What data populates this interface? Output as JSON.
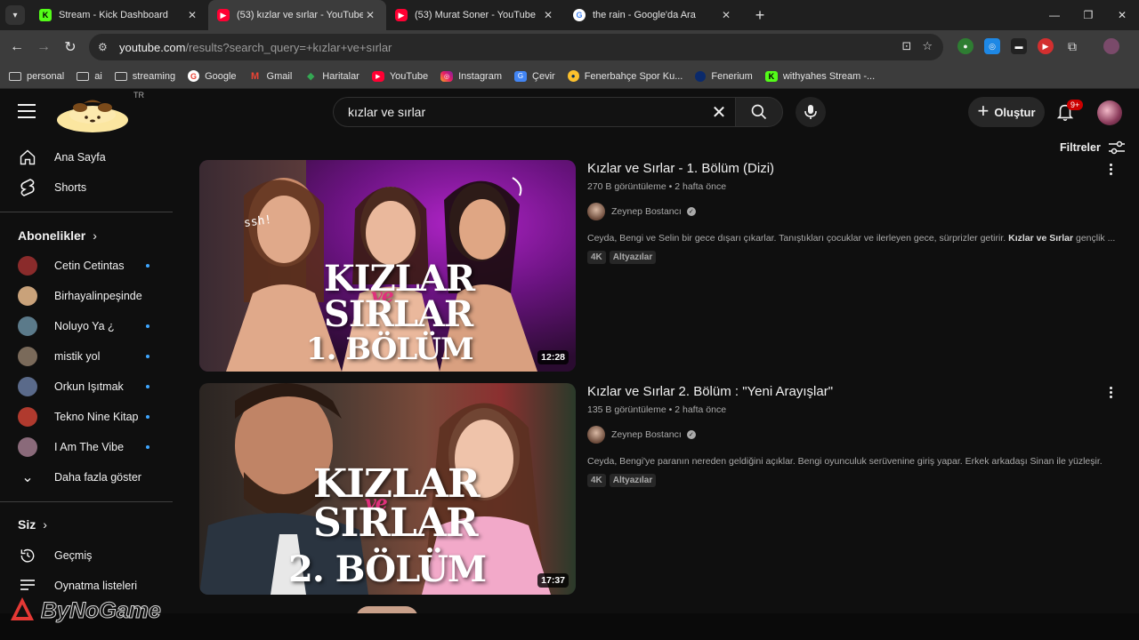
{
  "browser": {
    "tabs": [
      {
        "title": "Stream - Kick Dashboard",
        "favicon": "kick-icon"
      },
      {
        "title": "(53) kızlar ve sırlar - YouTube",
        "favicon": "youtube-icon",
        "active": true
      },
      {
        "title": "(53) Murat Soner - YouTube",
        "favicon": "youtube-icon"
      },
      {
        "title": "the rain - Google'da Ara",
        "favicon": "google-icon"
      }
    ],
    "url_host": "youtube.com",
    "url_path": "/results?search_query=+kızlar+ve+sırlar",
    "bookmarks": [
      {
        "label": "personal",
        "icon": "folder-icon"
      },
      {
        "label": "ai",
        "icon": "folder-icon"
      },
      {
        "label": "streaming",
        "icon": "folder-icon"
      },
      {
        "label": "Google",
        "icon": "google-icon"
      },
      {
        "label": "Gmail",
        "icon": "gmail-icon"
      },
      {
        "label": "Haritalar",
        "icon": "maps-icon"
      },
      {
        "label": "YouTube",
        "icon": "youtube-icon"
      },
      {
        "label": "Instagram",
        "icon": "instagram-icon"
      },
      {
        "label": "Çevir",
        "icon": "translate-icon"
      },
      {
        "label": "Fenerbahçe Spor Ku...",
        "icon": "fenerbahce-icon"
      },
      {
        "label": "Fenerium",
        "icon": "fenerium-icon"
      },
      {
        "label": "withyahes Stream -...",
        "icon": "kick-icon"
      }
    ]
  },
  "youtube": {
    "region": "TR",
    "search_query": "kızlar ve sırlar",
    "create_label": "Oluştur",
    "notification_count": "9+",
    "filters_label": "Filtreler",
    "sidebar": {
      "main": [
        {
          "label": "Ana Sayfa",
          "icon": "home-icon"
        },
        {
          "label": "Shorts",
          "icon": "shorts-icon"
        }
      ],
      "subscriptions_heading": "Abonelikler",
      "subscriptions": [
        {
          "label": "Cetin Cetintas",
          "new": true,
          "color": "#8a2b2b"
        },
        {
          "label": "Birhayalinpeşinde",
          "new": false,
          "color": "#c9a27a"
        },
        {
          "label": "Noluyo Ya ¿",
          "new": true,
          "color": "#5b7a8a"
        },
        {
          "label": "mistik yol",
          "new": true,
          "color": "#7a6a5a"
        },
        {
          "label": "Orkun Işıtmak",
          "new": true,
          "color": "#5a6a8a"
        },
        {
          "label": "Tekno Nine Kitap",
          "new": true,
          "color": "#b03a2e"
        },
        {
          "label": "I Am The Vibe",
          "new": true,
          "color": "#8a6a7a"
        }
      ],
      "show_more_label": "Daha fazla göster",
      "you_heading": "Siz",
      "you_items": [
        {
          "label": "Geçmiş",
          "icon": "history-icon"
        },
        {
          "label": "Oynatma listeleri",
          "icon": "playlist-icon"
        }
      ]
    },
    "results": [
      {
        "title": "Kızlar ve Sırlar - 1. Bölüm (Dizi)",
        "views": "270 B görüntüleme",
        "age": "2 hafta önce",
        "channel": "Zeynep Bostancı",
        "description_plain": "Ceyda, Bengi ve Selin bir gece dışarı çıkarlar. Tanıştıkları çocuklar ve ilerleyen gece, sürprizler getirir. ",
        "description_bold": "Kızlar ve Sırlar",
        "description_tail": " gençlik ...",
        "tags": [
          "4K",
          "Altyazılar"
        ],
        "duration": "12:28",
        "thumb_line1": "KIZLAR",
        "thumb_ve": "ve",
        "thumb_line2": "SIRLAR",
        "thumb_episode": "1. BÖLÜM",
        "thumb_whisper": "ssh!"
      },
      {
        "title": "Kızlar ve Sırlar 2. Bölüm : \"Yeni Arayışlar\"",
        "views": "135 B görüntüleme",
        "age": "2 hafta önce",
        "channel": "Zeynep Bostancı",
        "description_plain": "Ceyda, Bengi'ye paranın nereden geldiğini açıklar. Bengi oyunculuk serüvenine giriş yapar. Erkek arkadaşı Sinan ile yüzleşir.",
        "tags": [
          "4K",
          "Altyazılar"
        ],
        "duration": "17:37",
        "thumb_line1": "KIZLAR",
        "thumb_ve": "ve",
        "thumb_line2": "SIRLAR",
        "thumb_episode": "2. BÖLÜM"
      }
    ]
  },
  "watermark": "ByNoGame",
  "colors": {
    "accent_red": "#ff0033",
    "verified_blue": "#3ea6ff",
    "ve_pink": "#e1307c"
  }
}
